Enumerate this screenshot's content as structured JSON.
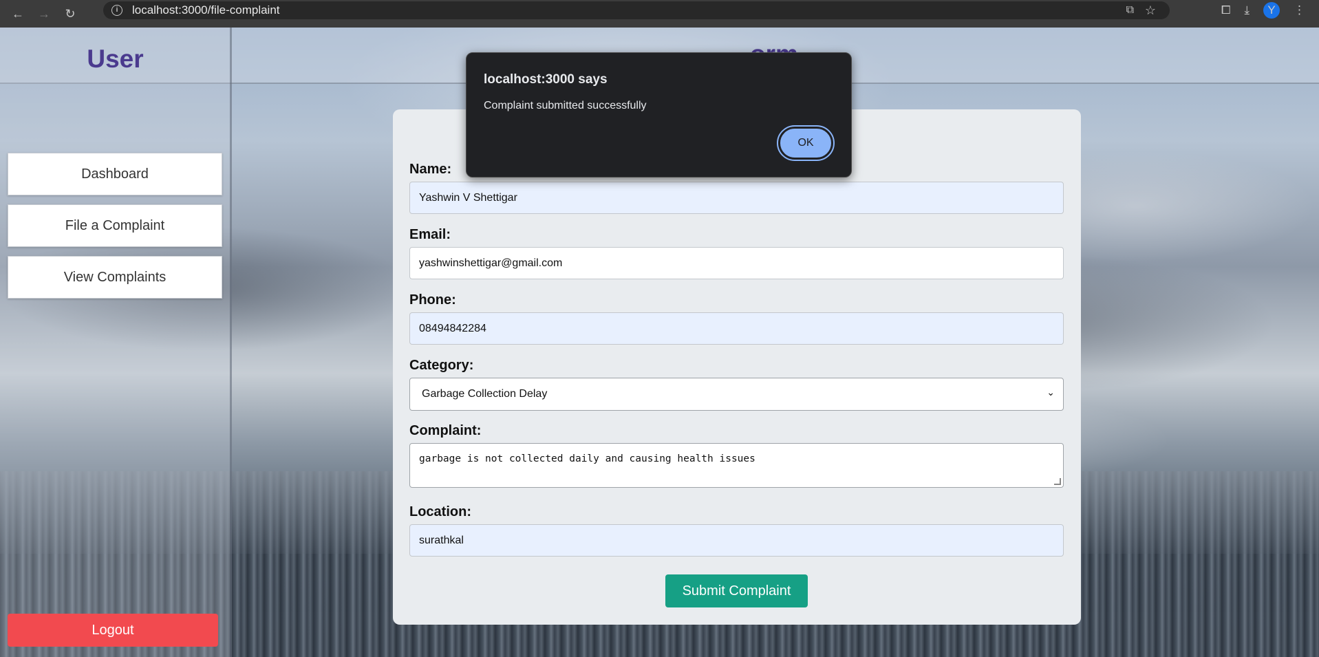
{
  "browser": {
    "url": "localhost:3000/file-complaint",
    "back_icon": "←",
    "forward_icon": "→",
    "reload_icon": "↻",
    "avatar_initial": "Y"
  },
  "header": {
    "title_visible_fragment": "orm"
  },
  "sidebar": {
    "title": "User",
    "items": [
      {
        "label": "Dashboard"
      },
      {
        "label": "File a Complaint"
      },
      {
        "label": "View Complaints"
      }
    ],
    "logout_label": "Logout"
  },
  "form": {
    "name_label": "Name:",
    "name_value": "Yashwin V Shettigar",
    "email_label": "Email:",
    "email_value": "yashwinshettigar@gmail.com",
    "phone_label": "Phone:",
    "phone_value": "08494842284",
    "category_label": "Category:",
    "category_value": "Garbage Collection Delay",
    "complaint_label": "Complaint:",
    "complaint_value": "garbage is not collected daily and causing health issues",
    "location_label": "Location:",
    "location_value": "surathkal",
    "submit_label": "Submit Complaint"
  },
  "dialog": {
    "title": "localhost:3000 says",
    "message": "Complaint submitted successfully",
    "ok_label": "OK"
  },
  "colors": {
    "accent_title": "#4a3a8e",
    "submit": "#16a085",
    "logout": "#f24a4f",
    "dialog_button": "#8ab4f8"
  }
}
